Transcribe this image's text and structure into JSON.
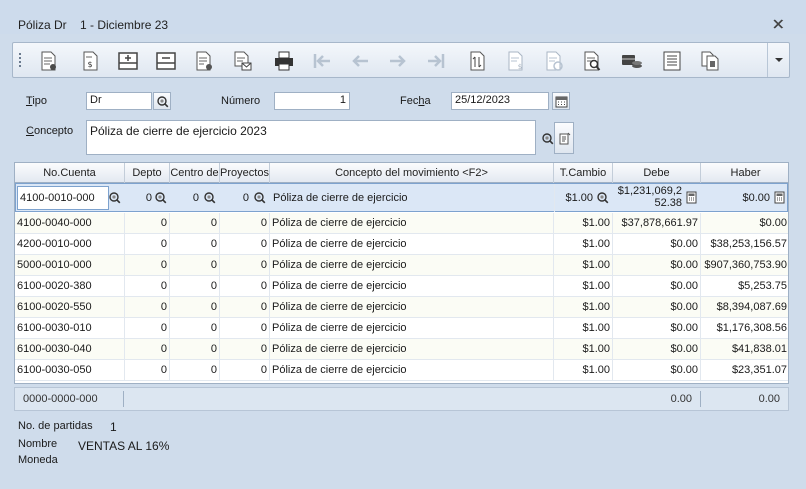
{
  "window": {
    "title": "Póliza Dr    1 - Diciembre 23"
  },
  "toolbar": {
    "icons": [
      "new-document-icon",
      "invoice-icon",
      "add-row-icon",
      "remove-row-icon",
      "document-settings-icon",
      "email-document-icon",
      "print-icon",
      "first-icon",
      "previous-icon",
      "next-icon",
      "last-icon",
      "calculate-icon",
      "accounts-icon",
      "refresh-document-icon",
      "search-document-icon",
      "payment-icon",
      "list-icon",
      "copy-icon"
    ]
  },
  "form": {
    "tipo_label": "Tipo",
    "tipo_value": "Dr",
    "numero_label": "Número",
    "numero_value": "1",
    "fecha_label": "Fecha",
    "fecha_value": "25/12/2023",
    "concepto_label": "Concepto",
    "concepto_value": "Póliza de cierre de ejercicio 2023"
  },
  "grid": {
    "headers": [
      "No.Cuenta",
      "Depto",
      "Centro de",
      "Proyectos",
      "Concepto del movimiento <F2>",
      "T.Cambio",
      "Debe",
      "Haber"
    ],
    "rows": [
      {
        "cuenta": "4100-0010-000",
        "depto": "0",
        "centro": "0",
        "proyecto": "0",
        "concepto": "Póliza de cierre de ejercicio",
        "tcambio": "$1.00",
        "debe_1": "$1,231,069,2",
        "debe_2": "52.38",
        "haber": "$0.00"
      },
      {
        "cuenta": "4100-0040-000",
        "depto": "0",
        "centro": "0",
        "proyecto": "0",
        "concepto": "Póliza de cierre de ejercicio",
        "tcambio": "$1.00",
        "debe": "$37,878,661.97",
        "haber": "$0.00"
      },
      {
        "cuenta": "4200-0010-000",
        "depto": "0",
        "centro": "0",
        "proyecto": "0",
        "concepto": "Póliza de cierre de ejercicio",
        "tcambio": "$1.00",
        "debe": "$0.00",
        "haber": "$38,253,156.57"
      },
      {
        "cuenta": "5000-0010-000",
        "depto": "0",
        "centro": "0",
        "proyecto": "0",
        "concepto": "Póliza de cierre de ejercicio",
        "tcambio": "$1.00",
        "debe": "$0.00",
        "haber": "$907,360,753.90"
      },
      {
        "cuenta": "6100-0020-380",
        "depto": "0",
        "centro": "0",
        "proyecto": "0",
        "concepto": "Póliza de cierre de ejercicio",
        "tcambio": "$1.00",
        "debe": "$0.00",
        "haber": "$5,253.75"
      },
      {
        "cuenta": "6100-0020-550",
        "depto": "0",
        "centro": "0",
        "proyecto": "0",
        "concepto": "Póliza de cierre de ejercicio",
        "tcambio": "$1.00",
        "debe": "$0.00",
        "haber": "$8,394,087.69"
      },
      {
        "cuenta": "6100-0030-010",
        "depto": "0",
        "centro": "0",
        "proyecto": "0",
        "concepto": "Póliza de cierre de ejercicio",
        "tcambio": "$1.00",
        "debe": "$0.00",
        "haber": "$1,176,308.56"
      },
      {
        "cuenta": "6100-0030-040",
        "depto": "0",
        "centro": "0",
        "proyecto": "0",
        "concepto": "Póliza de cierre de ejercicio",
        "tcambio": "$1.00",
        "debe": "$0.00",
        "haber": "$41,838.01"
      },
      {
        "cuenta": "6100-0030-050",
        "depto": "0",
        "centro": "0",
        "proyecto": "0",
        "concepto": "Póliza de cierre de ejercicio",
        "tcambio": "$1.00",
        "debe": "$0.00",
        "haber": "$23,351.07"
      }
    ]
  },
  "totals": {
    "cuenta": "0000-0000-000",
    "debe": "0.00",
    "haber": "0.00"
  },
  "info": {
    "partidas_label": "No. de partidas",
    "partidas_value": "1",
    "nombre_label": "Nombre",
    "nombre_value": "VENTAS AL 16%",
    "moneda_label": "Moneda"
  },
  "colors": {
    "accent": "#7da2ce",
    "selection": "#dbe7f6",
    "background": "#cfdceb"
  }
}
